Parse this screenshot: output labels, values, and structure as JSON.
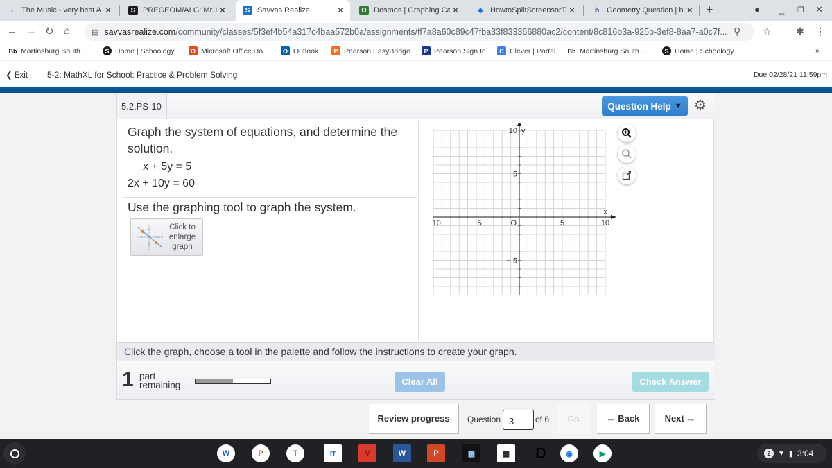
{
  "browser": {
    "tabs": [
      {
        "title": "The Music - very best A",
        "favicon": "music-icon",
        "color": "#7b4ad6",
        "glyph": "♪",
        "active": false
      },
      {
        "title": "PREGEOM/ALG: Mr. Bur",
        "favicon": "schoology-icon",
        "color": "#1c1c1c",
        "glyph": "S",
        "active": false
      },
      {
        "title": "Savvas Realize",
        "favicon": "savvas-icon",
        "color": "#1d6fd6",
        "glyph": "S",
        "active": true
      },
      {
        "title": "Desmos | Graphing Cal",
        "favicon": "desmos-icon",
        "color": "#2e7d32",
        "glyph": "D",
        "active": false
      },
      {
        "title": "HowtoSplitScreensorTa",
        "favicon": "diamond-icon",
        "color": "#1a73e8",
        "glyph": "◆",
        "active": false
      },
      {
        "title": "Geometry Question | ba",
        "favicon": "bartleby-icon",
        "color": "#1a237e",
        "glyph": "b",
        "active": false
      }
    ],
    "new_tab_label": "+",
    "url_host": "savvasrealize.com",
    "url_path": "/community/classes/5f3ef4b54a317c4baa572b0a/assignments/ff7a8a60c89c47fba33f833366880ac2/content/8c816b3a-925b-3ef8-8aa7-a0c7f...",
    "bookmarks": [
      {
        "label": "Martinsburg South...",
        "icon": "blackboard-icon",
        "glyph": "Bb",
        "color": "#222"
      },
      {
        "label": "Home | Schoology",
        "icon": "schoology-icon",
        "glyph": "S",
        "color": "#1c1c1c"
      },
      {
        "label": "Microsoft Office Ho...",
        "icon": "office-icon",
        "glyph": "O",
        "color": "#e64a19"
      },
      {
        "label": "Outlook",
        "icon": "outlook-icon",
        "glyph": "O",
        "color": "#0a64ad"
      },
      {
        "label": "Pearson EasyBridge",
        "icon": "pearson-icon",
        "glyph": "P",
        "color": "#f37021"
      },
      {
        "label": "Pearson Sign In",
        "icon": "pearson-signin-icon",
        "glyph": "P",
        "color": "#1a3a8f"
      },
      {
        "label": "Clever | Portal",
        "icon": "clever-icon",
        "glyph": "C",
        "color": "#3f7ee8"
      },
      {
        "label": "Martinsburg South...",
        "icon": "blackboard-icon",
        "glyph": "Bb",
        "color": "#222"
      },
      {
        "label": "Home | Schoology",
        "icon": "schoology-icon",
        "glyph": "S",
        "color": "#1c1c1c"
      }
    ],
    "bookmarks_overflow": "»"
  },
  "assignment": {
    "exit_label": "Exit",
    "title": "5-2: MathXL for School: Practice & Problem Solving",
    "due": "Due 02/28/21 11:59pm"
  },
  "question": {
    "id": "5.2.PS-10",
    "help_label": "Question Help",
    "prompt": "Graph the system of equations, and determine the solution.",
    "equation1": "x + 5y = 5",
    "equation2": "2x + 10y = 60",
    "instruction": "Use the graphing tool to graph the system.",
    "enlarge_label": "Click to enlarge graph",
    "graph": {
      "x_min": -10,
      "x_max": 10,
      "y_min": -9,
      "y_max": 10,
      "x_label": "x",
      "y_label": "y",
      "x_ticks": [
        {
          "v": -10,
          "t": "− 10"
        },
        {
          "v": -5,
          "t": "− 5"
        },
        {
          "v": 5,
          "t": "5"
        },
        {
          "v": 10,
          "t": "10"
        }
      ],
      "y_ticks": [
        {
          "v": 10,
          "t": "10"
        },
        {
          "v": 5,
          "t": "5"
        },
        {
          "v": -5,
          "t": "− 5"
        }
      ],
      "origin_label": "O"
    },
    "graph_tools": [
      "zoom-in",
      "zoom-out",
      "pop-out"
    ],
    "instructions_bar": "Click the graph, choose a tool in the palette and follow the instructions to create your graph.",
    "parts_remaining_count": "1",
    "parts_remaining_label_1": "part",
    "parts_remaining_label_2": "remaining",
    "progress_fraction": 0.5,
    "clear_all_label": "Clear All",
    "check_answer_label": "Check Answer"
  },
  "navigation": {
    "review_label": "Review progress",
    "question_label": "Question",
    "question_value": "3",
    "of_label": "of 6",
    "go_label": "Go",
    "back_label": "← Back",
    "next_label": "Next →"
  },
  "taskbar": {
    "apps": [
      {
        "name": "word-app-icon",
        "glyph": "W",
        "bg": "#fff",
        "fg": "#185abd",
        "round": true
      },
      {
        "name": "powerpoint-app-icon",
        "glyph": "P",
        "bg": "#fff",
        "fg": "#d24726",
        "round": true
      },
      {
        "name": "teams-app-icon",
        "glyph": "T",
        "bg": "#fff",
        "fg": "#5b5fc7",
        "round": true
      },
      {
        "name": "readandwrite-app-icon",
        "glyph": "rr",
        "bg": "#fff",
        "fg": "#2d6ab4",
        "round": false
      },
      {
        "name": "vivi-app-icon",
        "glyph": "V",
        "bg": "#d93a2b",
        "fg": "#7a1a12",
        "round": false
      },
      {
        "name": "word-web-icon",
        "glyph": "W",
        "bg": "#2b579a",
        "fg": "#fff",
        "round": false
      },
      {
        "name": "powerpoint-web-icon",
        "glyph": "P",
        "bg": "#d24726",
        "fg": "#fff",
        "round": false
      },
      {
        "name": "calculator-app-icon",
        "glyph": "▦",
        "bg": "#111",
        "fg": "#9cf",
        "round": false
      },
      {
        "name": "qr-reader-icon",
        "glyph": "▩",
        "bg": "#fff",
        "fg": "#222",
        "round": false
      },
      {
        "name": "docs-d-icon",
        "glyph": "D",
        "bg": "#202124",
        "fg": "#000",
        "round": false
      },
      {
        "name": "chrome-app-icon",
        "glyph": "◉",
        "bg": "#fff",
        "fg": "#1a73e8",
        "round": true
      },
      {
        "name": "play-store-icon",
        "glyph": "▶",
        "bg": "#fff",
        "fg": "#00a173",
        "round": true
      }
    ],
    "notification_count": "2",
    "time": "3:04"
  }
}
